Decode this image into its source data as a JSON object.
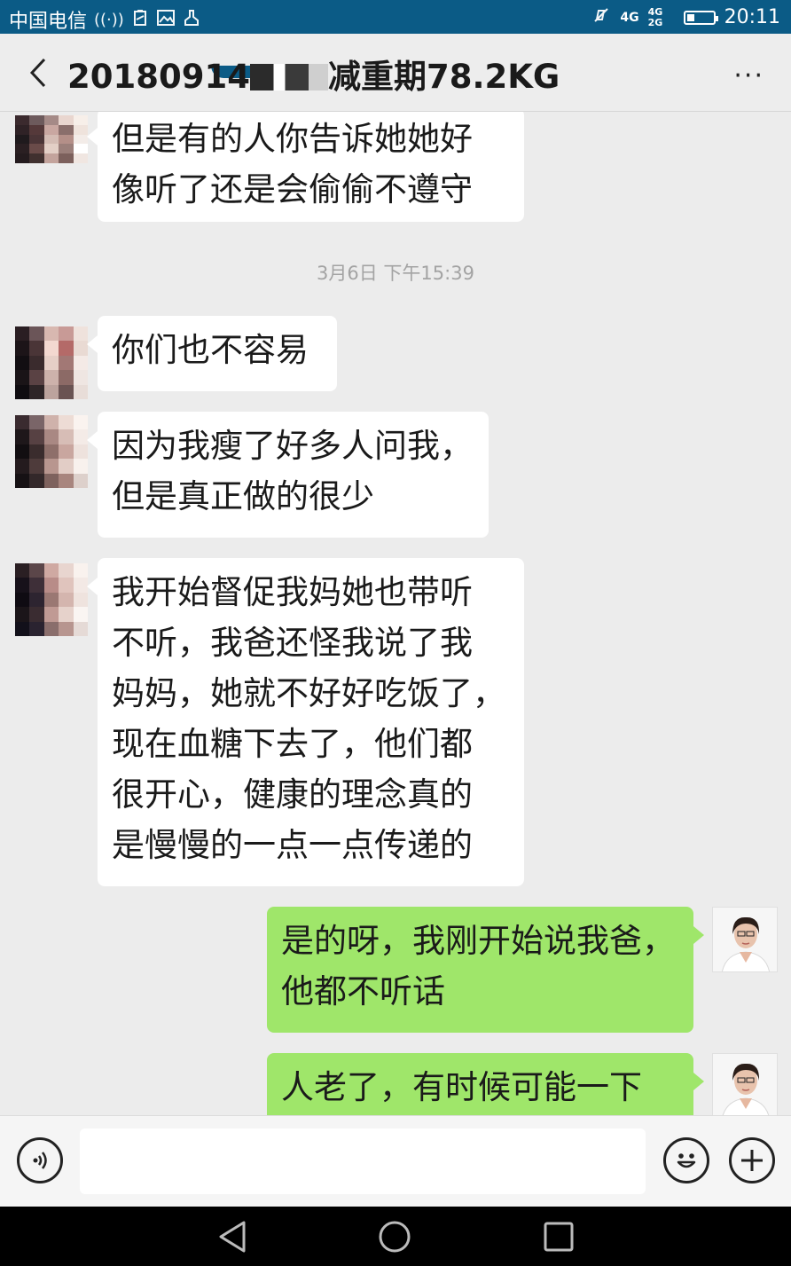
{
  "status_bar": {
    "carrier": "中国电信",
    "network_top": "4G",
    "network_bottom": "4G 2G",
    "battery_level": 0.3,
    "time": "20:11"
  },
  "header": {
    "title_prefix": "20180914",
    "title_suffix": "减重期78.2KG",
    "back_icon": "chevron-left-icon",
    "more_label": "···"
  },
  "chat": {
    "timestamp": "3月6日 下午15:39",
    "messages": [
      {
        "side": "in",
        "lines": [
          "但是有的人你告诉她她好",
          "像听了还是会偷偷不遵守"
        ]
      },
      {
        "side": "in",
        "lines": [
          "你们也不容易"
        ]
      },
      {
        "side": "in",
        "lines": [
          "因为我瘦了好多人问我，",
          "但是真正做的很少"
        ]
      },
      {
        "side": "in",
        "lines": [
          "我开始督促我妈她也带听",
          "不听，我爸还怪我说了我",
          "妈妈，她就不好好吃饭了，",
          "现在血糖下去了，他们都",
          "很开心，健康的理念真的",
          "是慢慢的一点一点传递的"
        ]
      },
      {
        "side": "out",
        "lines": [
          "是的呀，我刚开始说我爸，",
          "他都不听话"
        ]
      },
      {
        "side": "out",
        "lines": [
          "人老了，有时候可能一下"
        ]
      }
    ]
  },
  "input_bar": {
    "voice_icon": "voice-icon",
    "emoji_icon": "emoji-icon",
    "plus_icon": "plus-icon",
    "value": ""
  },
  "nav_bar": {
    "back_icon": "triangle-back-icon",
    "home_icon": "circle-home-icon",
    "recents_icon": "square-recents-icon"
  },
  "colors": {
    "status_bar": "#0b5b86",
    "sent_bubble": "#9fe66a",
    "received_bubble": "#ffffff",
    "chat_bg": "#ececec"
  }
}
